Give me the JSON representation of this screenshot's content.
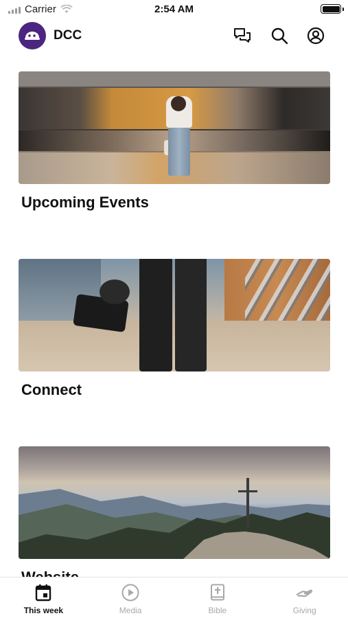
{
  "status_bar": {
    "carrier": "Carrier",
    "time": "2:54 AM"
  },
  "header": {
    "app_title": "DCC",
    "icons": [
      "chat-icon",
      "search-icon",
      "account-icon"
    ]
  },
  "cards": [
    {
      "title": "Upcoming Events",
      "image": "woman-at-train-station"
    },
    {
      "title": "Connect",
      "image": "person-with-camera"
    },
    {
      "title": "Website",
      "image": "mountain-cross"
    }
  ],
  "tabs": [
    {
      "label": "This week",
      "icon": "calendar-icon",
      "active": true
    },
    {
      "label": "Media",
      "icon": "play-icon",
      "active": false
    },
    {
      "label": "Bible",
      "icon": "bible-icon",
      "active": false
    },
    {
      "label": "Giving",
      "icon": "giving-hand-icon",
      "active": false
    }
  ],
  "colors": {
    "brand": "#4b2580",
    "active_tab": "#111111",
    "inactive_tab": "#a8a8a8"
  }
}
